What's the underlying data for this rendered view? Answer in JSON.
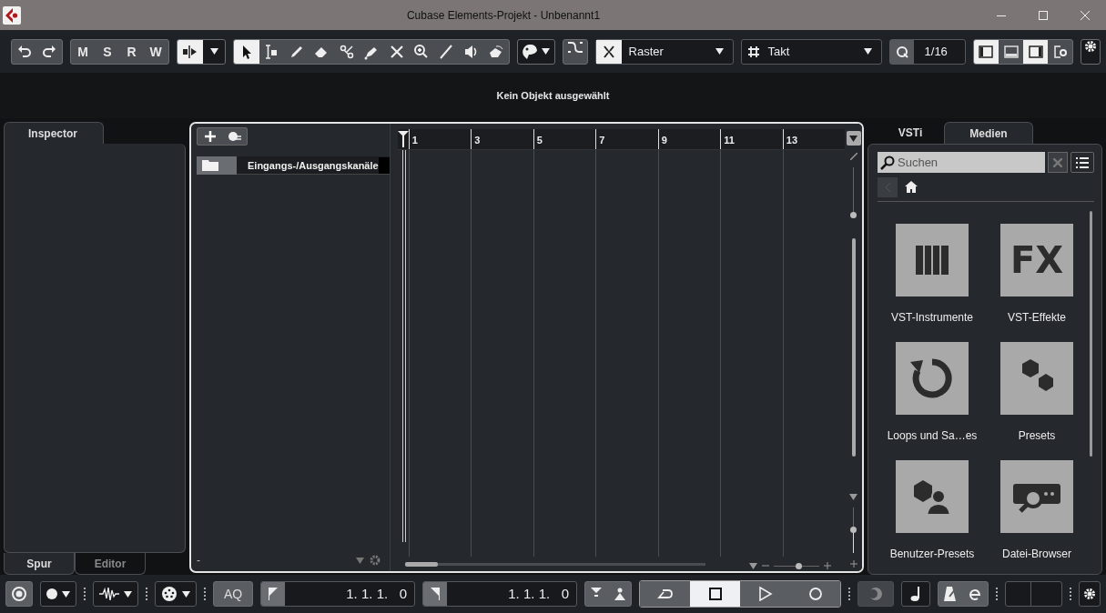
{
  "window": {
    "title": "Cubase Elements-Projekt - Unbenannt1"
  },
  "toolbar": {
    "automation": [
      {
        "label": "M"
      },
      {
        "label": "S"
      },
      {
        "label": "R"
      },
      {
        "label": "W"
      }
    ],
    "tools": [
      {
        "selected": true
      },
      {
        "selected": false
      },
      {
        "selected": false
      },
      {
        "selected": false
      },
      {
        "selected": false
      },
      {
        "selected": false
      },
      {
        "selected": false
      },
      {
        "selected": false
      },
      {
        "selected": false
      },
      {
        "selected": false
      },
      {
        "selected": false
      }
    ],
    "snap": {
      "on": true,
      "value": "Raster"
    },
    "grid": {
      "value": "Takt"
    },
    "quantize": {
      "value": "1/16"
    },
    "zones": [
      {
        "on": true
      },
      {
        "on": false
      },
      {
        "on": true
      }
    ]
  },
  "info_line": "Kein Objekt ausgewählt",
  "inspector": {
    "tabs": [
      {
        "label": "Inspector",
        "selected": true
      }
    ],
    "bottom_tabs": [
      {
        "label": "Spur",
        "selected": true
      },
      {
        "label": "Editor",
        "selected": false
      }
    ]
  },
  "project": {
    "tracks": [
      {
        "name": "Eingangs-/Ausgangskanäle"
      }
    ],
    "footer": "-",
    "ruler": [
      "1",
      "3",
      "5",
      "7",
      "9",
      "11",
      "13"
    ],
    "h_zoom": {
      "level": 0.55
    },
    "track_height": {
      "level": 0
    },
    "v_zoom": {
      "level": 0.5
    }
  },
  "media": {
    "tabs": [
      {
        "label": "VSTi",
        "selected": false
      },
      {
        "label": "Medien",
        "selected": true
      }
    ],
    "search": {
      "placeholder": "Suchen"
    },
    "effects_glyph": "FX",
    "tiles": [
      {
        "kind": "instruments",
        "label": "VST-Instrumente"
      },
      {
        "kind": "effects",
        "label": "VST-Effekte"
      },
      {
        "kind": "loops",
        "label": "Loops und Sa…es"
      },
      {
        "kind": "presets",
        "label": "Presets"
      },
      {
        "kind": "userpresets",
        "label": "Benutzer-Presets"
      },
      {
        "kind": "browser",
        "label": "Datei-Browser"
      }
    ]
  },
  "transport": {
    "aq": "AQ",
    "left_locator": "1. 1. 1.   0",
    "right_locator": "1. 1. 1.   0",
    "buttons": [
      {
        "kind": "cycle",
        "on": false
      },
      {
        "kind": "stop",
        "on": true
      },
      {
        "kind": "play",
        "on": false
      },
      {
        "kind": "record",
        "on": false
      }
    ]
  }
}
